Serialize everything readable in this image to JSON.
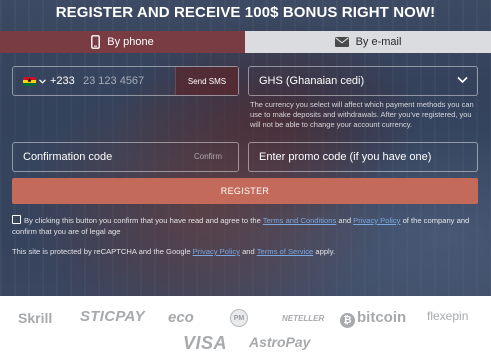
{
  "header": {
    "title": "REGISTER AND RECEIVE 100$ BONUS RIGHT NOW!"
  },
  "tabs": [
    {
      "label": "By phone",
      "icon": "smartphone-icon",
      "active": true
    },
    {
      "label": "By e-mail",
      "icon": "envelope-icon",
      "active": false
    }
  ],
  "phone": {
    "country_flag": "ghana-flag-icon",
    "dial_code": "+233",
    "placeholder": "23 123 4567",
    "send_sms_label": "Send SMS"
  },
  "currency": {
    "selected": "GHS (Ghanaian cedi)",
    "note": "The currency you select will affect which payment methods you can use to make deposits and withdrawals. After you've registered, you will not be able to change your account currency."
  },
  "confirmation": {
    "placeholder": "Confirmation code",
    "confirm_label": "Confirm"
  },
  "promo": {
    "placeholder": "Enter promo code (if you have one)"
  },
  "register_button": "REGISTER",
  "consent": {
    "text_before": "By clicking this button you confirm that you have read and agree to the",
    "terms_link": "Terms and Conditions",
    "and": "and",
    "privacy_link": "Privacy Policy",
    "text_after": "of the company and confirm that you are of legal age"
  },
  "recaptcha": {
    "text_before": "This site is protected by reCAPTCHA and the Google",
    "privacy_link": "Privacy Policy",
    "and": "and",
    "terms_link": "Terms of Service",
    "text_after": "apply."
  },
  "payments": {
    "skrill": "Skrill",
    "sticpay": "STICPAY",
    "eco": "eco",
    "pm": "PM",
    "neteller": "NETELLER",
    "bitcoin": "bitcoin",
    "flexepin": "flexepin",
    "visa": "VISA",
    "astropay": "AstroPay"
  },
  "colors": {
    "tab_active": "#7a3c43",
    "register": "#c46a5b",
    "link": "#7aa7e0",
    "logo_gray": "#a7a9ac"
  }
}
